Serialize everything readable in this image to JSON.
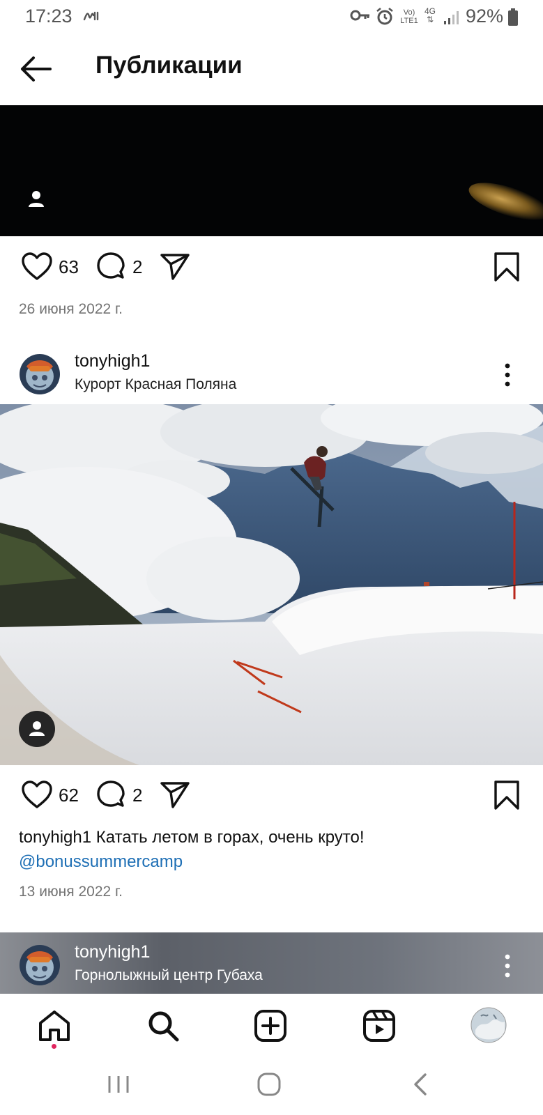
{
  "status_bar": {
    "time": "17:23",
    "battery": "92%",
    "icons": [
      "sync-icon",
      "key-icon",
      "alarm-icon",
      "volte-icon",
      "4g-icon",
      "signal-icon",
      "battery-icon"
    ],
    "volte_label": "Vo) LTE1",
    "network_label": "4G"
  },
  "header": {
    "title": "Публикации",
    "back_icon": "arrow-left-icon"
  },
  "posts": [
    {
      "likes": "63",
      "comments": "2",
      "date": "26 июня 2022 г."
    },
    {
      "username": "tonyhigh1",
      "location": "Курорт Красная Поляна",
      "likes": "62",
      "comments": "2",
      "caption_user": "tonyhigh1",
      "caption_text": "Катать летом в горах, очень круто!",
      "mention": "@bonussummercamp",
      "date": "13 июня 2022 г."
    },
    {
      "username": "tonyhigh1",
      "location": "Горнолыжный центр Губаха"
    }
  ],
  "bottom_nav": {
    "items": [
      "home-icon",
      "search-icon",
      "create-icon",
      "reels-icon",
      "profile-avatar"
    ],
    "active": "home-icon",
    "notification_color": "#e0245e"
  },
  "system_nav": [
    "recents-icon",
    "home-circle-icon",
    "back-chevron-icon"
  ],
  "colors": {
    "mention": "#1e6fb5",
    "date": "#737373"
  }
}
